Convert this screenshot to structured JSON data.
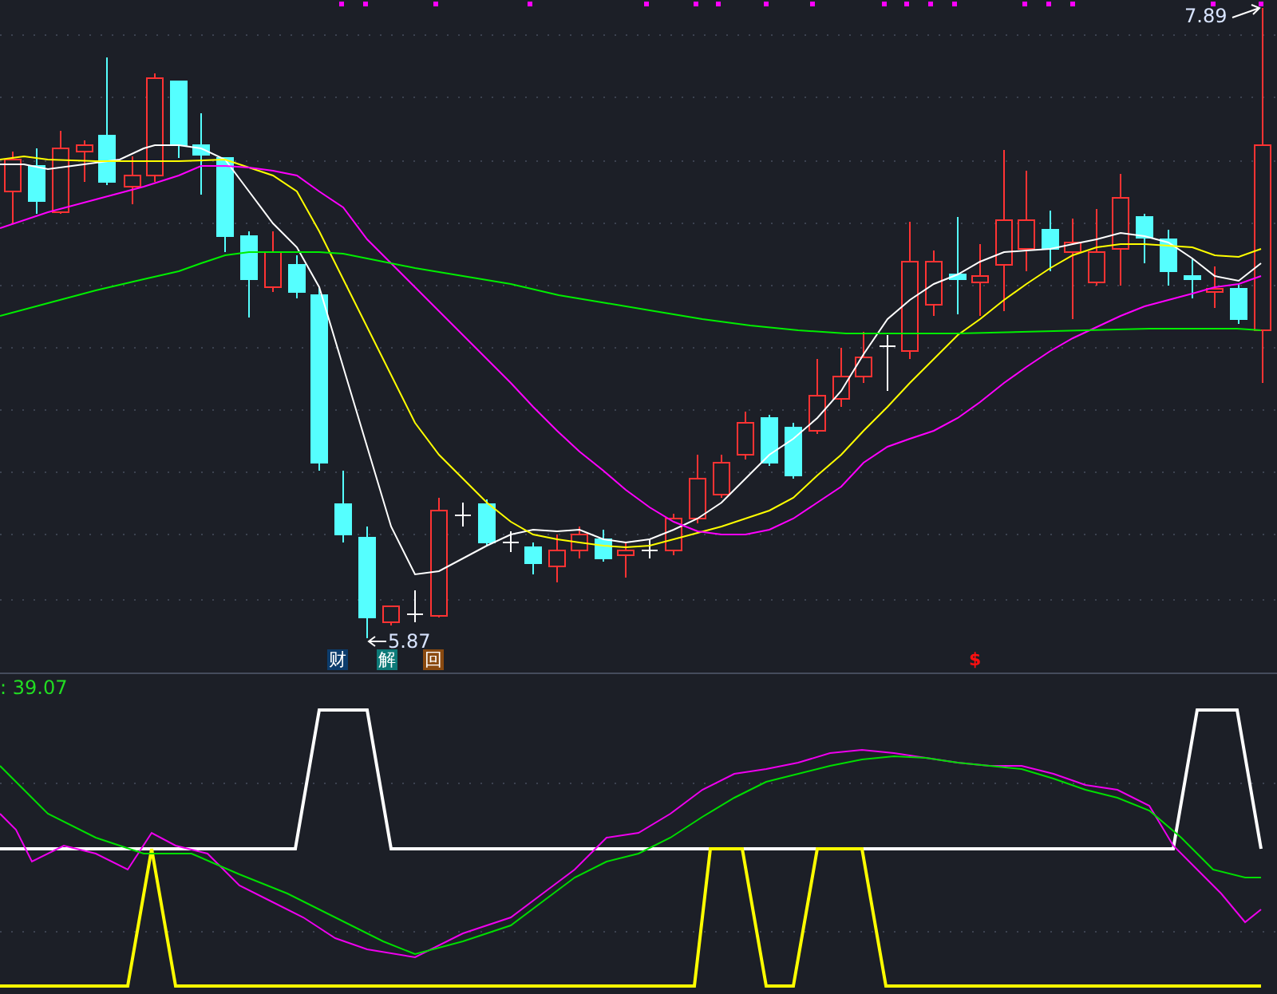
{
  "main_chart": {
    "high_label": "7.89",
    "low_label": "5.87",
    "event_icons": [
      {
        "kind": "finance",
        "text": "财"
      },
      {
        "kind": "unlock",
        "text": "解"
      },
      {
        "kind": "buyback",
        "text": "回"
      },
      {
        "kind": "dividend",
        "text": "$"
      }
    ]
  },
  "indicator_panel": {
    "value_label": ": 39.07"
  }
}
